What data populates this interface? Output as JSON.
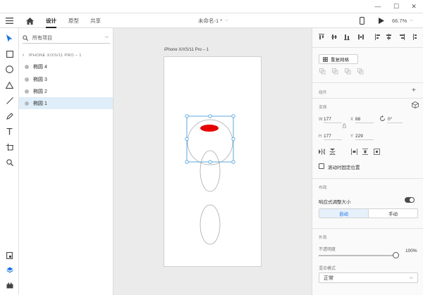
{
  "window": {
    "title": "未命名-1 *",
    "minimize_glyph": "—",
    "maximize_glyph": "☐",
    "close_glyph": "✕"
  },
  "toolbar": {
    "home_icon": "home-icon",
    "tabs": [
      {
        "label": "设计",
        "active": true
      },
      {
        "label": "原型",
        "active": false
      },
      {
        "label": "共享",
        "active": false
      }
    ],
    "zoom": "66.7%"
  },
  "tools": [
    "select-arrow-icon",
    "rectangle-icon",
    "ellipse-icon",
    "triangle-icon",
    "line-icon",
    "pen-icon",
    "text-icon",
    "artboard-icon",
    "zoom-icon"
  ],
  "rail_bottom": [
    "assets-icon",
    "layers-icon",
    "plugins-icon"
  ],
  "layers_panel": {
    "search_label": "所有项目",
    "artboard_name": "IPHONE X/XS/11 PRO – 1",
    "items": [
      {
        "label": "椭圆 4",
        "selected": false
      },
      {
        "label": "椭圆 3",
        "selected": false
      },
      {
        "label": "椭圆 2",
        "selected": false
      },
      {
        "label": "椭圆 1",
        "selected": true
      }
    ]
  },
  "canvas": {
    "artboard_title": "iPhone X/XS/11 Pro – 1",
    "accent_color": "#4a9fe0",
    "fill_color": "#e60000"
  },
  "props": {
    "repeat_grid_label": "重复网格",
    "components_label": "组件",
    "add_glyph": "+",
    "transform_label": "变换",
    "w_label": "W",
    "w_value": "177",
    "x_label": "X",
    "x_value": "88",
    "h_label": "H",
    "h_value": "177",
    "y_label": "Y",
    "y_value": "229",
    "rotation_value": "0°",
    "fix_scroll_label": "滚动时固定位置",
    "layout_label": "布局",
    "responsive_label": "响应式调整大小",
    "auto_label": "自动",
    "manual_label": "手动",
    "appearance_label": "外观",
    "opacity_label": "不透明度",
    "opacity_value": "100%",
    "blend_label": "混合模式",
    "blend_value": "正常"
  }
}
